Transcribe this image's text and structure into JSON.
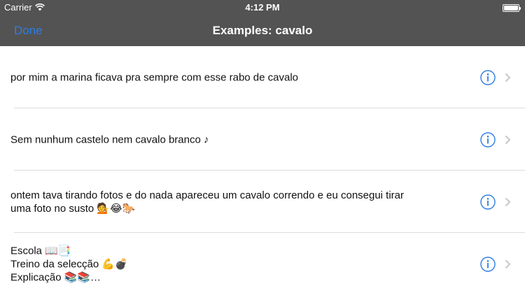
{
  "status_bar": {
    "carrier": "Carrier",
    "time": "4:12 PM"
  },
  "nav": {
    "done_label": "Done",
    "title": "Examples: cavalo"
  },
  "colors": {
    "header_bg": "#535353",
    "accent": "#2f7de1",
    "separator": "#dcdcdc",
    "chevron": "#c7c7cc"
  },
  "icons": {
    "info": "info-circle-icon",
    "disclosure": "chevron-right-icon"
  },
  "rows": [
    {
      "text": "por mim a marina ficava pra sempre com esse rabo de cavalo"
    },
    {
      "text": "Sem nunhum castelo nem cavalo branco ♪"
    },
    {
      "text": "ontem tava tirando fotos e do nada apareceu um cavalo correndo e eu consegui tirar\numa foto no susto 💁😂🐎"
    },
    {
      "text": "Escola 📖📑\nTreino da selecção 💪💣\nExplicação 📚📚…"
    }
  ]
}
